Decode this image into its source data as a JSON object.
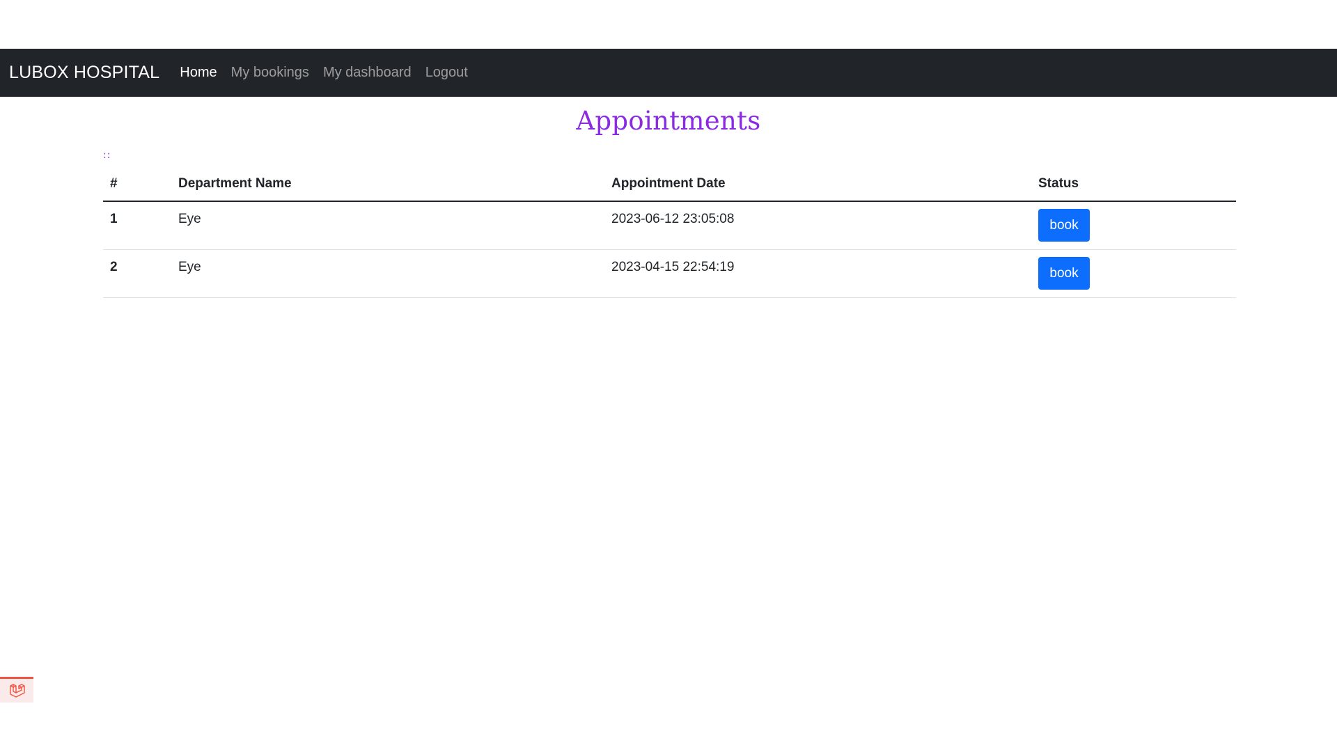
{
  "navbar": {
    "brand": "LUBOX HOSPITAL",
    "links": [
      {
        "label": "Home",
        "active": true
      },
      {
        "label": "My bookings",
        "active": false
      },
      {
        "label": "My dashboard",
        "active": false
      },
      {
        "label": "Logout",
        "active": false
      }
    ]
  },
  "page": {
    "title": "Appointments",
    "handle": "::"
  },
  "table": {
    "headers": {
      "index": "#",
      "department": "Department Name",
      "date": "Appointment Date",
      "status": "Status"
    },
    "rows": [
      {
        "index": "1",
        "department": "Eye",
        "date": "2023-06-12 23:05:08",
        "action": "book"
      },
      {
        "index": "2",
        "department": "Eye",
        "date": "2023-04-15 22:54:19",
        "action": "book"
      }
    ]
  },
  "colors": {
    "navbar_bg": "#212529",
    "title": "#8a2be2",
    "button": "#0d6efd",
    "debugbar_accent": "#f05340"
  },
  "icons": {
    "debugbar": "laravel-logo-icon"
  }
}
